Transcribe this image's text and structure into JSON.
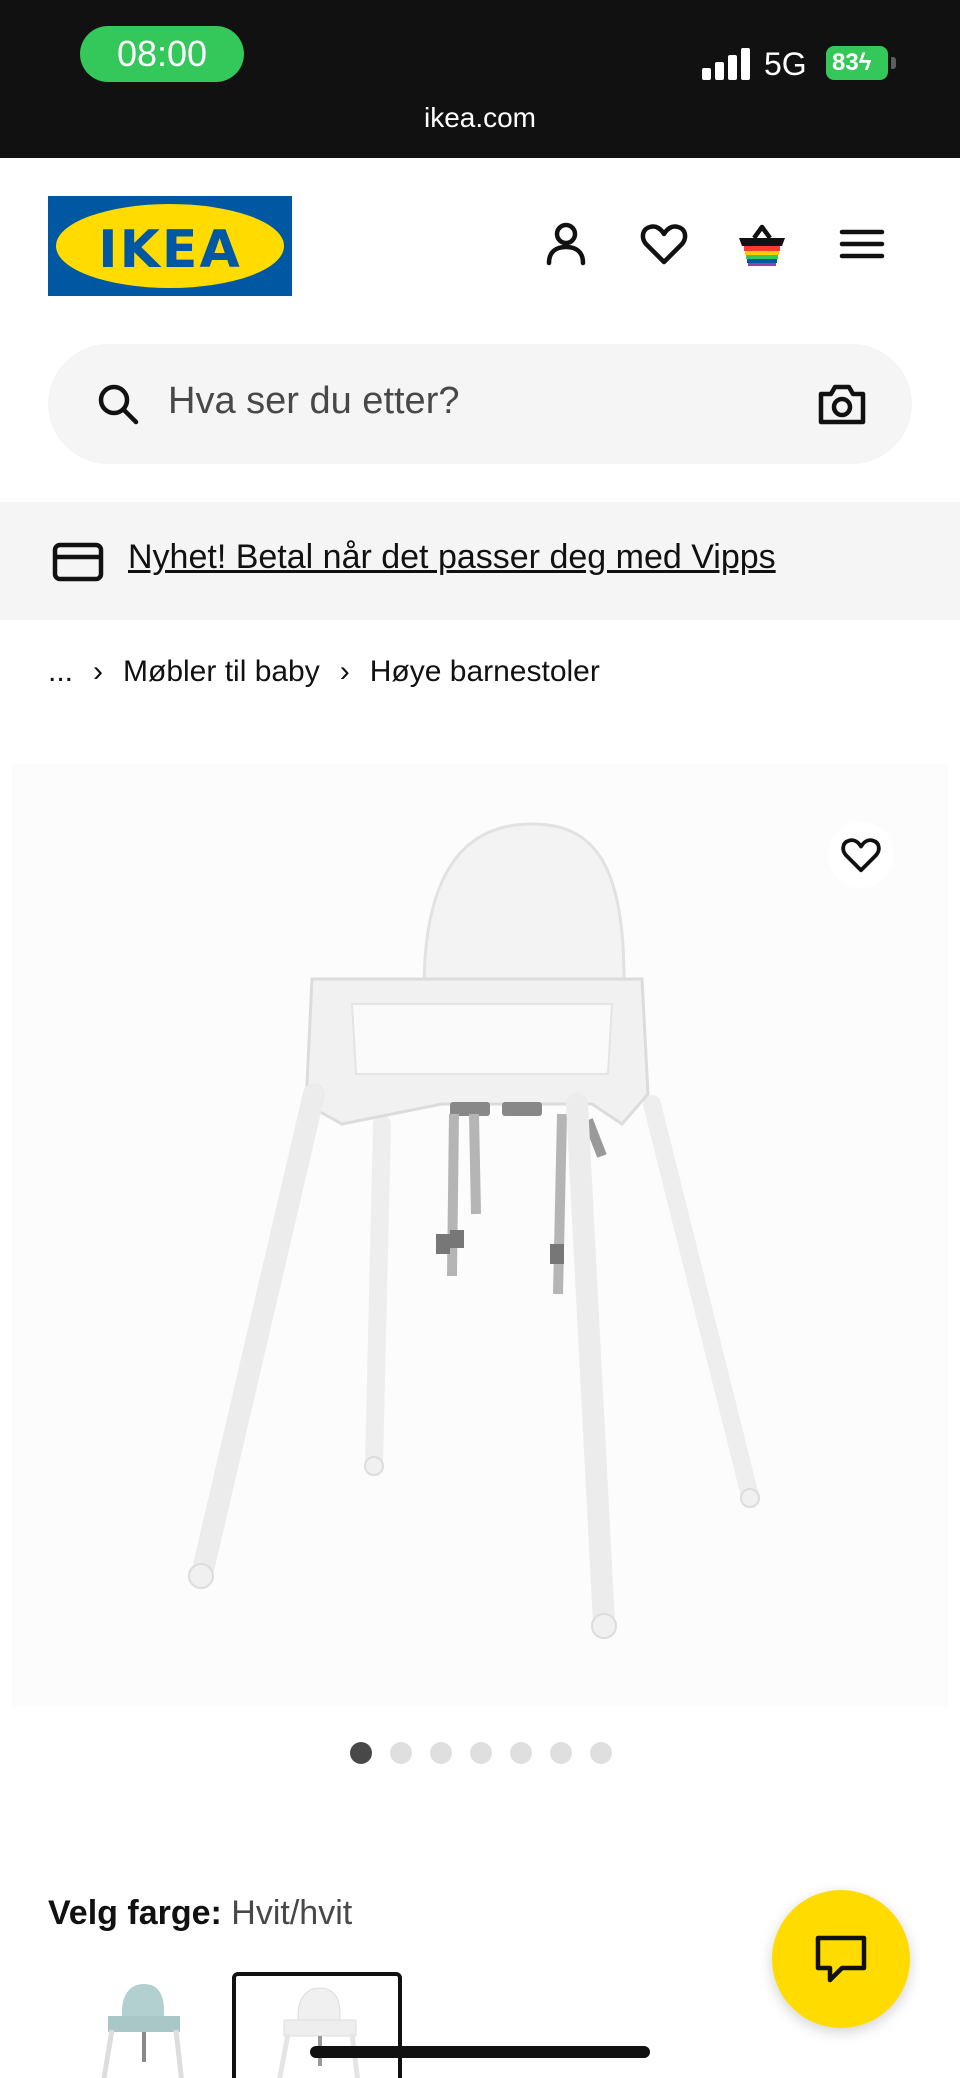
{
  "status_bar": {
    "time": "08:00",
    "network": "5G",
    "battery_percent": "83",
    "url": "ikea.com"
  },
  "header": {
    "logo_text": "IKEA",
    "icons": [
      "profile-icon",
      "heart-icon",
      "basket-icon",
      "menu-icon"
    ]
  },
  "search": {
    "placeholder": "Hva ser du etter?",
    "icons": [
      "search-icon",
      "camera-icon"
    ]
  },
  "promo": {
    "text": "Nyhet! Betal når det passer deg med Vipps",
    "icon": "card-icon"
  },
  "breadcrumb": {
    "ellipsis": "...",
    "items": [
      "Møbler til baby",
      "Høye barnestoler"
    ]
  },
  "gallery": {
    "dot_count": 7,
    "active_index": 0
  },
  "color_select": {
    "label": "Velg farge:",
    "value": "Hvit/hvit"
  },
  "colors": {
    "ikea_blue": "#0058a3",
    "ikea_yellow": "#ffdb00",
    "status_green": "#34c759"
  }
}
